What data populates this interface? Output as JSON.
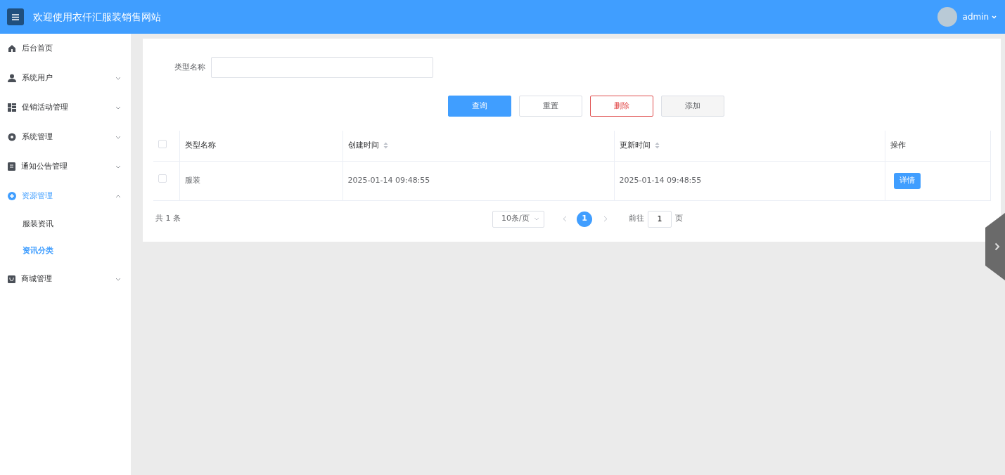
{
  "header": {
    "title": "欢迎使用衣仟汇服装销售网站",
    "user": "admin"
  },
  "sidebar": {
    "items": [
      {
        "label": "后台首页",
        "expandable": false,
        "selected": false
      },
      {
        "label": "系统用户",
        "expandable": true,
        "expanded": false,
        "selected": false
      },
      {
        "label": "促销活动管理",
        "expandable": true,
        "expanded": false,
        "selected": false
      },
      {
        "label": "系统管理",
        "expandable": true,
        "expanded": false,
        "selected": false
      },
      {
        "label": "通知公告管理",
        "expandable": true,
        "expanded": false,
        "selected": false
      },
      {
        "label": "资源管理",
        "expandable": true,
        "expanded": true,
        "selected": true,
        "children": [
          {
            "label": "服装资讯",
            "selected": false
          },
          {
            "label": "资讯分类",
            "selected": true
          }
        ]
      },
      {
        "label": "商城管理",
        "expandable": true,
        "expanded": false,
        "selected": false
      }
    ]
  },
  "search": {
    "label": "类型名称"
  },
  "buttons": [
    {
      "label": "查询",
      "kind": "primary"
    },
    {
      "label": "重置",
      "kind": "default"
    },
    {
      "label": "删除",
      "kind": "danger"
    },
    {
      "label": "添加",
      "kind": "hover"
    }
  ],
  "table": {
    "columns": [
      {
        "label": "类型名称",
        "sortable": false
      },
      {
        "label": "创建时间",
        "sortable": true
      },
      {
        "label": "更新时间",
        "sortable": true
      },
      {
        "label": "操作",
        "sortable": false
      }
    ],
    "header_checked": false,
    "rows": [
      {
        "checked": false,
        "cells": [
          "服装",
          "2025-01-14 09:48:55",
          "2025-01-14 09:48:55"
        ],
        "action": "详情"
      }
    ]
  },
  "pagination": {
    "total": "共 1 条",
    "page_size": "10条/页",
    "pages": [
      {
        "label": "1",
        "selected": true
      }
    ],
    "goto_label": "前往",
    "goto_value": "1",
    "goto_suffix": "页"
  }
}
